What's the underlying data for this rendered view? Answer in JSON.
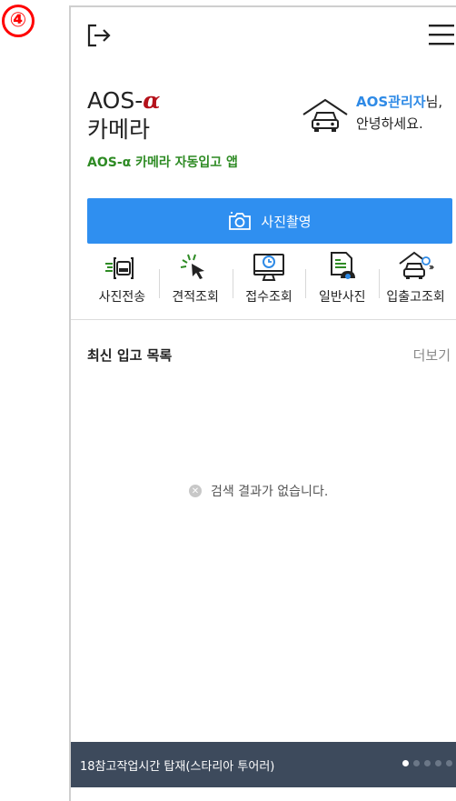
{
  "step_badge": "④",
  "brand": {
    "name_prefix": "AOS-",
    "name_alpha": "α",
    "name_line2": "카메라"
  },
  "greeting": {
    "name": "AOS관리자",
    "suffix": "님,",
    "line2": "안녕하세요."
  },
  "app_subtitle": "AOS-α 카메라 자동입고 앱",
  "photo_button": "사진촬영",
  "quick_menu": [
    {
      "label": "사진전송",
      "icon": "photo-send-icon"
    },
    {
      "label": "견적조회",
      "icon": "cursor-click-icon"
    },
    {
      "label": "접수조회",
      "icon": "monitor-clock-icon"
    },
    {
      "label": "일반사진",
      "icon": "document-photo-icon"
    },
    {
      "label": "입출고조회",
      "icon": "garage-car-icon"
    }
  ],
  "recent": {
    "title": "최신 입고 목록",
    "more": "더보기",
    "empty": "검색 결과가 없습니다."
  },
  "ticker": {
    "text": "18참고작업시간 탑재(스타리아 투어러)",
    "page_count": 5,
    "active_page": 1
  },
  "colors": {
    "primary": "#2f8ff0",
    "accent_green": "#2e8b24",
    "alpha_red": "#b5121b",
    "bottom_bar": "#3d4a5c",
    "badge": "#ff0000"
  }
}
